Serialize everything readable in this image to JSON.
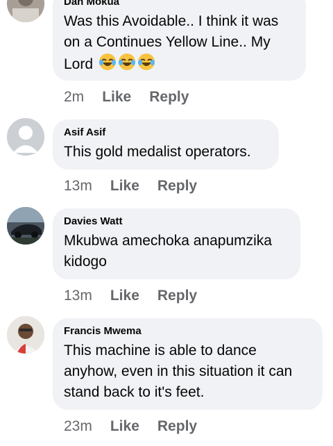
{
  "comments": [
    {
      "author": "Dan Mokua",
      "text_line1": "Was this Avoidable.. I think it was",
      "text_line2": "on a Continues Yellow Line.. My",
      "text_line3": "Lord",
      "emojis": [
        "laughing-tears-emoji",
        "laughing-tears-emoji",
        "laughing-tears-emoji"
      ],
      "time": "2m",
      "like": "Like",
      "reply": "Reply"
    },
    {
      "author": "Asif Asif",
      "text": "This gold medalist operators.",
      "avatar_icon": "default-profile-icon",
      "time": "13m",
      "like": "Like",
      "reply": "Reply"
    },
    {
      "author": "Davies Watt",
      "text_line1": "Mkubwa amechoka anapumzika",
      "text_line2": "kidogo",
      "time": "13m",
      "like": "Like",
      "reply": "Reply"
    },
    {
      "author": "Francis Mwema",
      "text_line1": "This machine is able to dance",
      "text_line2": "anyhow, even in this situation it can",
      "text_line3": "stand back to it's feet.",
      "time": "23m",
      "like": "Like",
      "reply": "Reply"
    }
  ],
  "colors": {
    "bubble": "#f0f2f5",
    "meta": "#65676b",
    "text": "#050505"
  }
}
